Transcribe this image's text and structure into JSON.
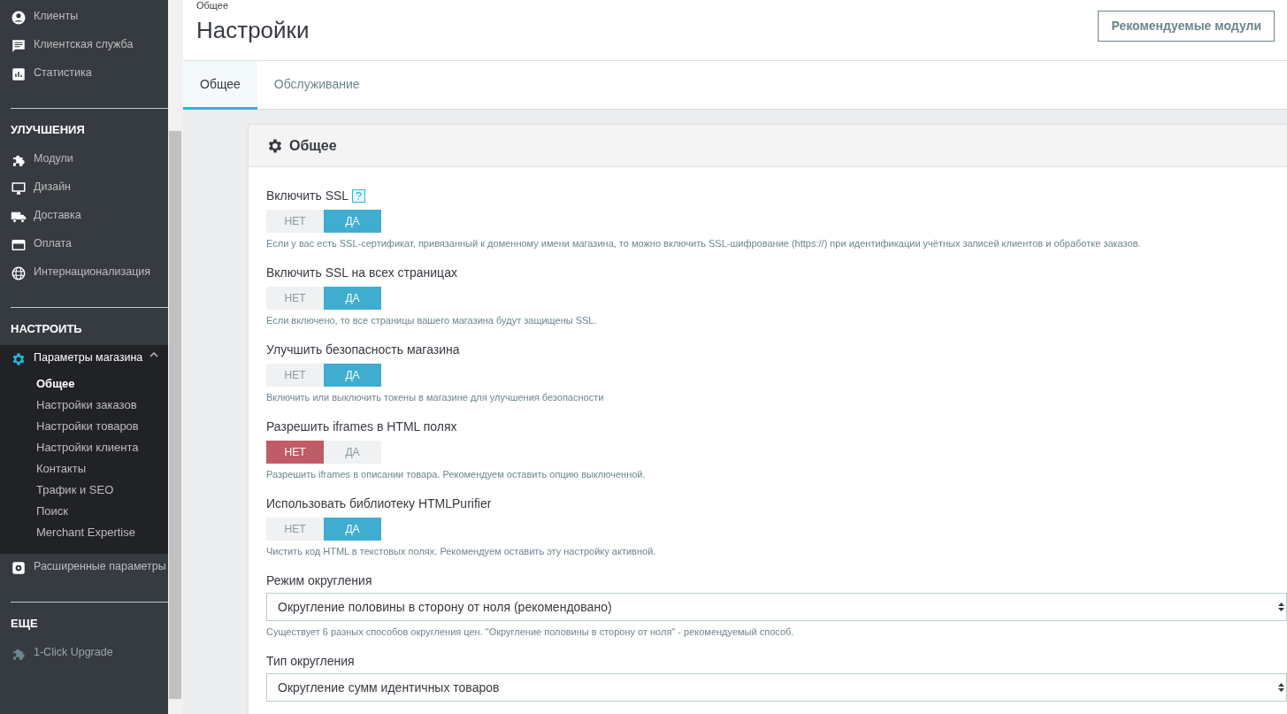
{
  "sidebar": {
    "sections": [
      {
        "items": [
          {
            "label": "Клиенты",
            "selected": false
          },
          {
            "label": "Клиентская служба",
            "selected": false
          },
          {
            "label": "Статистика",
            "selected": false
          }
        ]
      },
      {
        "heading": "УЛУЧШЕНИЯ",
        "items": [
          {
            "label": "Модули",
            "selected": false
          },
          {
            "label": "Дизайн",
            "selected": false
          },
          {
            "label": "Доставка",
            "selected": false
          },
          {
            "label": "Оплата",
            "selected": false
          },
          {
            "label": "Интернационализация",
            "selected": false
          }
        ]
      },
      {
        "heading": "НАСТРОИТЬ",
        "items": [
          {
            "label": "Параметры магазина",
            "selected": true,
            "expanded": true,
            "children": [
              {
                "label": "Общее",
                "selected": true
              },
              {
                "label": "Настройки заказов",
                "selected": false
              },
              {
                "label": "Настройки товаров",
                "selected": false
              },
              {
                "label": "Настройки клиента",
                "selected": false
              },
              {
                "label": "Контакты",
                "selected": false
              },
              {
                "label": "Трафик и SEO",
                "selected": false
              },
              {
                "label": "Поиск",
                "selected": false
              },
              {
                "label": "Merchant Expertise",
                "selected": false
              }
            ]
          },
          {
            "label": "Расширенные параметры",
            "selected": false
          }
        ]
      },
      {
        "heading": "ЕЩЕ",
        "items": [
          {
            "label": "1-Click Upgrade",
            "selected": false,
            "disabled": true
          }
        ]
      }
    ]
  },
  "header": {
    "breadcrumb": "Общее",
    "title": "Настройки",
    "button": "Рекомендуемые модули"
  },
  "tabs": [
    {
      "label": "Общее",
      "selected": true
    },
    {
      "label": "Обслуживание",
      "selected": false
    }
  ],
  "panel": {
    "title": "Общее",
    "fields": [
      {
        "kind": "switch",
        "label": "Включить SSL",
        "help": true,
        "options": [
          {
            "label": "НЕТ",
            "selected": false
          },
          {
            "label": "ДА",
            "selected": true
          }
        ],
        "description": "Если у вас есть SSL-сертификат, привязанный к доменному имени магазина, то можно включить SSL-шифрование (https://) при идентификации учётных записей клиентов и обработке заказов."
      },
      {
        "kind": "switch",
        "label": "Включить SSL на всех страницах",
        "options": [
          {
            "label": "НЕТ",
            "selected": false
          },
          {
            "label": "ДА",
            "selected": true
          }
        ],
        "description": "Если включено, то все страницы вашего магазина будут защищены SSL."
      },
      {
        "kind": "switch",
        "label": "Улучшить безопасность магазина",
        "options": [
          {
            "label": "НЕТ",
            "selected": false
          },
          {
            "label": "ДА",
            "selected": true
          }
        ],
        "description": "Включить или выключить токены в магазине для улучшения безопасности"
      },
      {
        "kind": "switch",
        "label": "Разрешить iframes в HTML полях",
        "options": [
          {
            "label": "НЕТ",
            "selected": true
          },
          {
            "label": "ДА",
            "selected": false
          }
        ],
        "description": "Разрешить iframes в описании товара. Рекомендуем оставить опцию выключенной."
      },
      {
        "kind": "switch",
        "label": "Использовать библиотеку HTMLPurifier",
        "options": [
          {
            "label": "НЕТ",
            "selected": false
          },
          {
            "label": "ДА",
            "selected": true
          }
        ],
        "description": "Чистить код HTML в текстовых полях. Рекомендуем оставить эту настройку активной."
      },
      {
        "kind": "select",
        "label": "Режим округления",
        "value": "Округление половины в сторону от ноля (рекомендовано)",
        "description": "Существует 6 разных способов округления цен. \"Округление половины в сторону от ноля\" - рекомендуемый способ."
      },
      {
        "kind": "select",
        "label": "Тип округления",
        "value": "Округление сумм идентичных товаров"
      }
    ]
  }
}
